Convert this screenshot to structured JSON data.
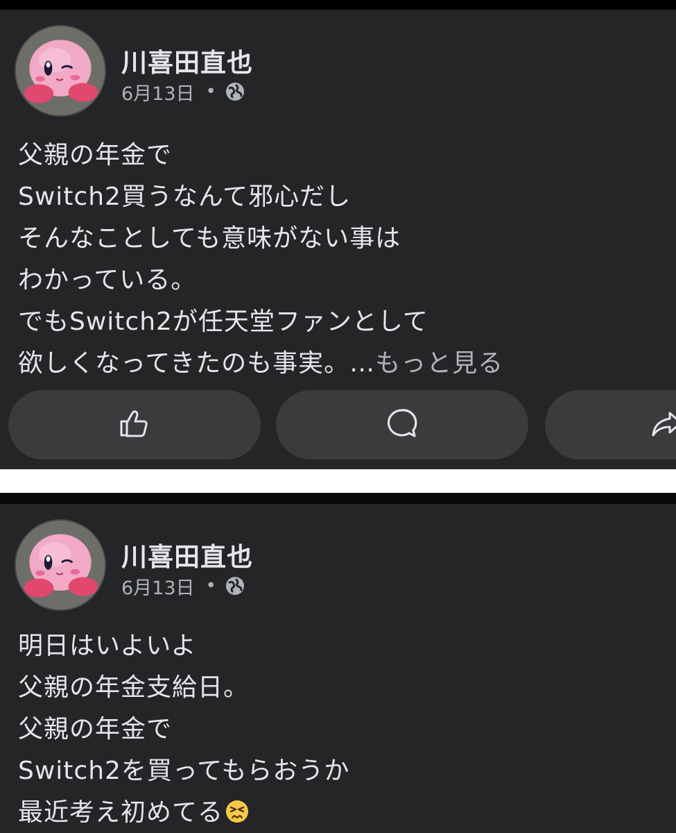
{
  "posts": [
    {
      "author": "川喜田直也",
      "date": "6月13日",
      "meta_separator": "•",
      "privacy_icon": "globe-icon",
      "lines": [
        "父親の年金で",
        "Switch2買うなんて邪心だし",
        "そんなことしても意味がない事は",
        "わかっている。",
        "でもSwitch2が任天堂ファンとして",
        "欲しくなってきたのも事実。…"
      ],
      "see_more": "もっと見る",
      "actions": {
        "like_icon": "thumbs-up-icon",
        "comment_icon": "comment-bubble-icon",
        "share_icon": "share-arrow-icon"
      }
    },
    {
      "author": "川喜田直也",
      "date": "6月13日",
      "meta_separator": "•",
      "privacy_icon": "globe-icon",
      "lines": [
        "明日はいよいよ",
        "父親の年金支給日。",
        "父親の年金で",
        "Switch2を買ってもらおうか",
        "最近考え初めてる"
      ],
      "trailing_emoji": "persevering-face-emoji"
    }
  ],
  "colors": {
    "post_background": "#242526",
    "page_background": "#000000",
    "primary_text": "#e4e6eb",
    "secondary_text": "#b0b3b8",
    "action_button": "#3a3b3c",
    "separator": "#ffffff"
  }
}
